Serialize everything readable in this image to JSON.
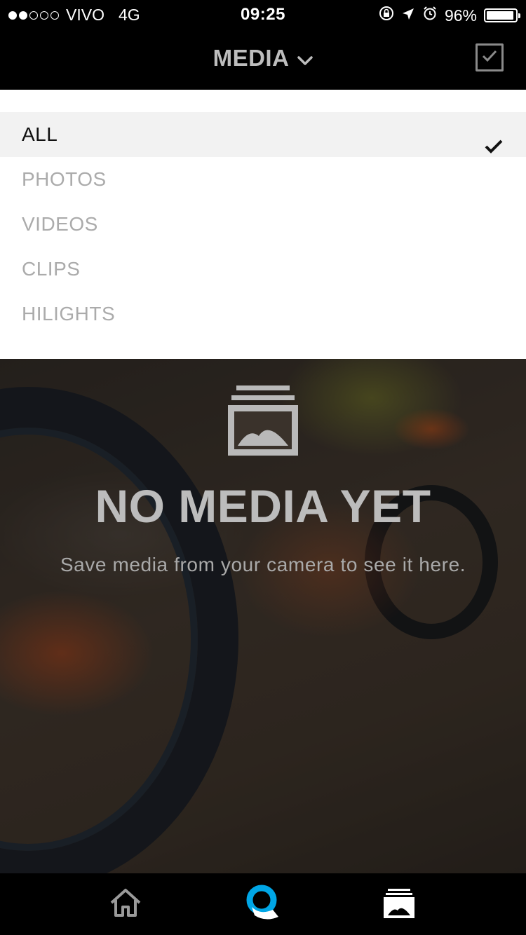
{
  "status_bar": {
    "carrier": "VIVO",
    "network": "4G",
    "time": "09:25",
    "battery": "96%",
    "battery_level": 0.96,
    "signal_bars": 2,
    "signal_total": 5
  },
  "header": {
    "title": "MEDIA"
  },
  "filter": {
    "items": [
      {
        "label": "ALL",
        "selected": true
      },
      {
        "label": "PHOTOS",
        "selected": false
      },
      {
        "label": "VIDEOS",
        "selected": false
      },
      {
        "label": "CLIPS",
        "selected": false
      },
      {
        "label": "HILIGHTS",
        "selected": false
      }
    ]
  },
  "empty_state": {
    "title": "NO MEDIA YET",
    "subtitle": "Save media from your camera to see it here."
  },
  "tab_bar": {
    "tabs": [
      {
        "icon": "home-icon"
      },
      {
        "icon": "quik-logo-icon"
      },
      {
        "icon": "media-library-icon",
        "active": true
      }
    ]
  },
  "colors": {
    "brand_blue": "#00a6e6",
    "selected_row": "#f2f2f2"
  }
}
